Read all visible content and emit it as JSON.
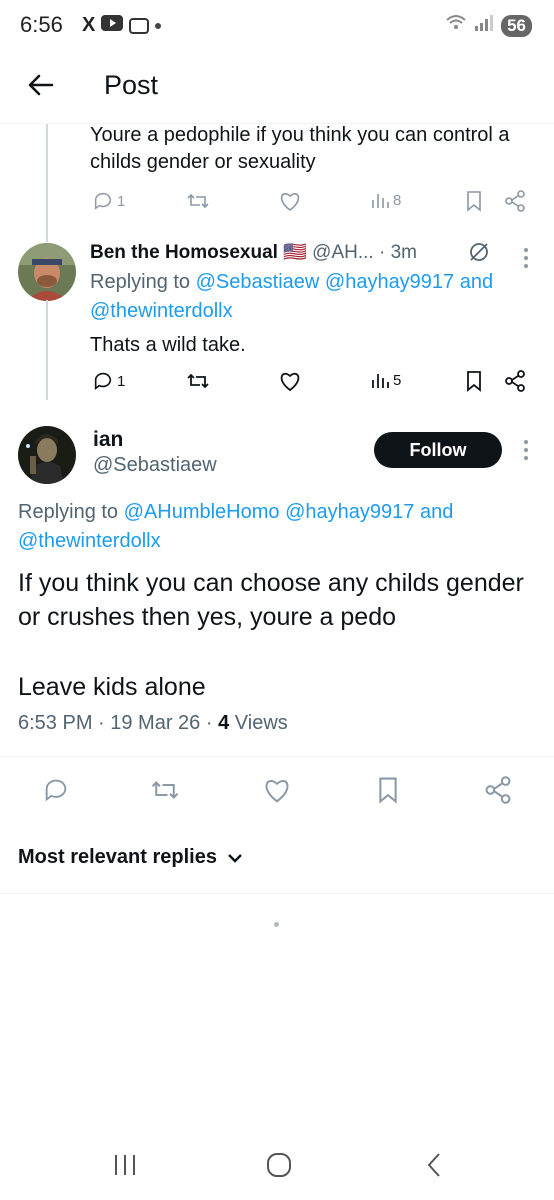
{
  "status_bar": {
    "time": "6:56",
    "x_icon": "X",
    "battery": "56"
  },
  "header": {
    "title": "Post"
  },
  "prev_tweet": {
    "text": "Youre a pedophile if you think you can control a childs gender or sexuality",
    "reply_count": "1",
    "views": "8"
  },
  "reply_tweet": {
    "name": "Ben the Homosexual",
    "flag": "🇺🇸",
    "handle": "@AH...",
    "time": "· 3m",
    "replying_prefix": "Replying to",
    "mention1": "@Sebastiaew",
    "mention2": "@hayhay9917",
    "and": "and",
    "mention3": "@thewinterdollx",
    "text": "Thats a wild take.",
    "reply_count": "1",
    "views": "5"
  },
  "main_tweet": {
    "name": "ian",
    "handle": "@Sebastiaew",
    "follow_label": "Follow",
    "replying_prefix": "Replying to",
    "mention1": "@AHumbleHomo",
    "mention2": "@hayhay9917",
    "and": "and",
    "mention3": "@thewinterdollx",
    "text_line1": "If you think you can choose any childs gender or crushes then yes, youre a pedo",
    "text_line2": "Leave kids alone",
    "timestamp": "6:53 PM · 19 Mar 26 ·",
    "views_count": "4",
    "views_label": "Views"
  },
  "replies_sort": {
    "label": "Most relevant replies"
  },
  "colors": {
    "accent": "#1d9bf0",
    "text": "#0f1419",
    "muted": "#536471",
    "follow_bg": "#0f1419"
  }
}
